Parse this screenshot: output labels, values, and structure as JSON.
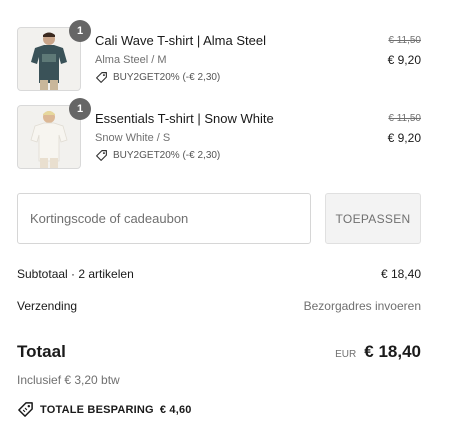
{
  "cart": {
    "items": [
      {
        "name": "Cali Wave T-shirt | Alma Steel",
        "variant": "Alma Steel / M",
        "discount": "BUY2GET20% (-€ 2,30)",
        "old_price": "€ 11,50",
        "price": "€ 9,20",
        "quantity": "1",
        "image_color": "#3a5258"
      },
      {
        "name": "Essentials T-shirt | Snow White",
        "variant": "Snow White / S",
        "discount": "BUY2GET20% (-€ 2,30)",
        "old_price": "€ 11,50",
        "price": "€ 9,20",
        "quantity": "1",
        "image_color": "#f3efe8"
      }
    ]
  },
  "discount_code": {
    "placeholder": "Kortingscode of cadeaubon",
    "value": "",
    "apply_label": "TOEPASSEN"
  },
  "summary": {
    "subtotal_label": "Subtotaal · 2 artikelen",
    "subtotal_value": "€ 18,40",
    "shipping_label": "Verzending",
    "shipping_value": "Bezorgadres invoeren",
    "total_label": "Totaal",
    "currency": "EUR",
    "total_value": "€ 18,40",
    "tax_note": "Inclusief € 3,20 btw",
    "savings_label": "TOTALE BESPARING",
    "savings_value": "€ 4,60"
  },
  "icons": {
    "discount_tag": "tag-icon",
    "savings_tag": "tag-icon"
  }
}
